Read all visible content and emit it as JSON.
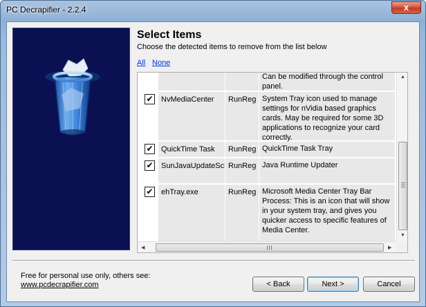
{
  "window": {
    "title": "PC Decrapifier - 2.2.4",
    "close_glyph": "x"
  },
  "header": {
    "title": "Select Items",
    "subtitle": "Choose the detected items to remove from the list below"
  },
  "links": {
    "all": "All",
    "none": "None"
  },
  "list": {
    "rows": [
      {
        "checked": null,
        "check_glyph": "",
        "name": "",
        "type": "",
        "description": "Can be modified through the control panel."
      },
      {
        "checked": true,
        "check_glyph": "✔",
        "name": "NvMediaCenter",
        "type": "RunReg",
        "description": "System Tray icon used to manage settings for nVidia based graphics cards. May be required for some 3D applications to recognize your card correctly."
      },
      {
        "checked": true,
        "check_glyph": "✔",
        "name": "QuickTime Task",
        "type": "RunReg",
        "description": "QuickTime Task Tray"
      },
      {
        "checked": true,
        "check_glyph": "✔",
        "name": "SunJavaUpdateSched",
        "type": "RunReg",
        "description": "Java Runtime Updater"
      },
      {
        "checked": true,
        "check_glyph": "✔",
        "name": "ehTray.exe",
        "type": "RunReg",
        "description": "Microsoft Media Center Tray Bar Process: This is an icon that will show in your system tray, and gives you quicker access to specific features of Media Center."
      }
    ],
    "scroll": {
      "up": "▲",
      "down": "▼",
      "left": "◀",
      "right": "▶"
    }
  },
  "footer": {
    "line1": "Free for personal use only, others see:",
    "link": "www.pcdecrapifier.com"
  },
  "buttons": {
    "back": "< Back",
    "next": "Next >",
    "cancel": "Cancel"
  },
  "colors": {
    "banner_bg": "#0a1052",
    "link": "#0033cc",
    "close": "#c13b22"
  },
  "icons": {
    "banner": "recycle-bin-icon"
  }
}
